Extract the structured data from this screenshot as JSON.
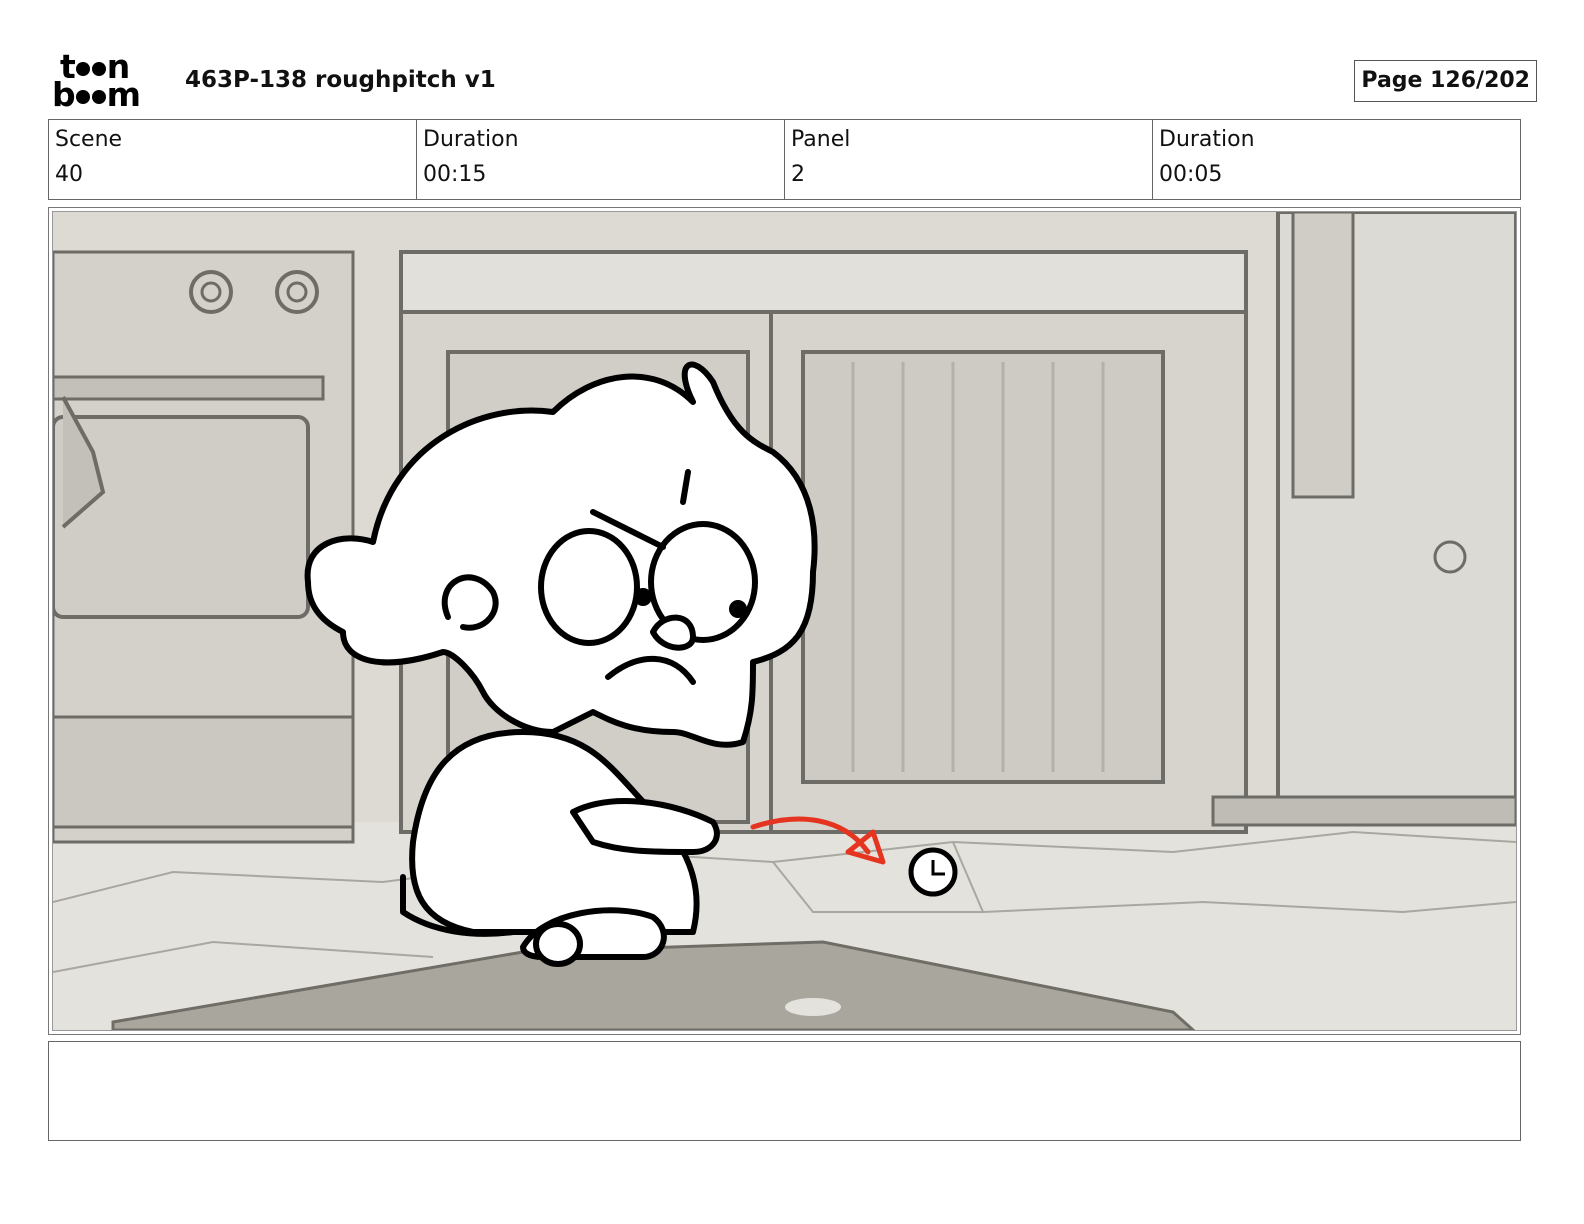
{
  "header": {
    "logo_line1": [
      "t",
      "n"
    ],
    "logo_line2": [
      "b",
      "m"
    ],
    "logo_text": "toonboom",
    "title": "463P-138 roughpitch v1",
    "page": "Page 126/202"
  },
  "info": {
    "scene_label": "Scene",
    "scene_value": "40",
    "scene_duration_label": "Duration",
    "scene_duration_value": "00:15",
    "panel_label": "Panel",
    "panel_value": "2",
    "panel_duration_label": "Duration",
    "panel_duration_value": "00:05"
  },
  "panel": {
    "description": "",
    "arrow_color": "#e53520"
  },
  "notes": {
    "text": ""
  }
}
